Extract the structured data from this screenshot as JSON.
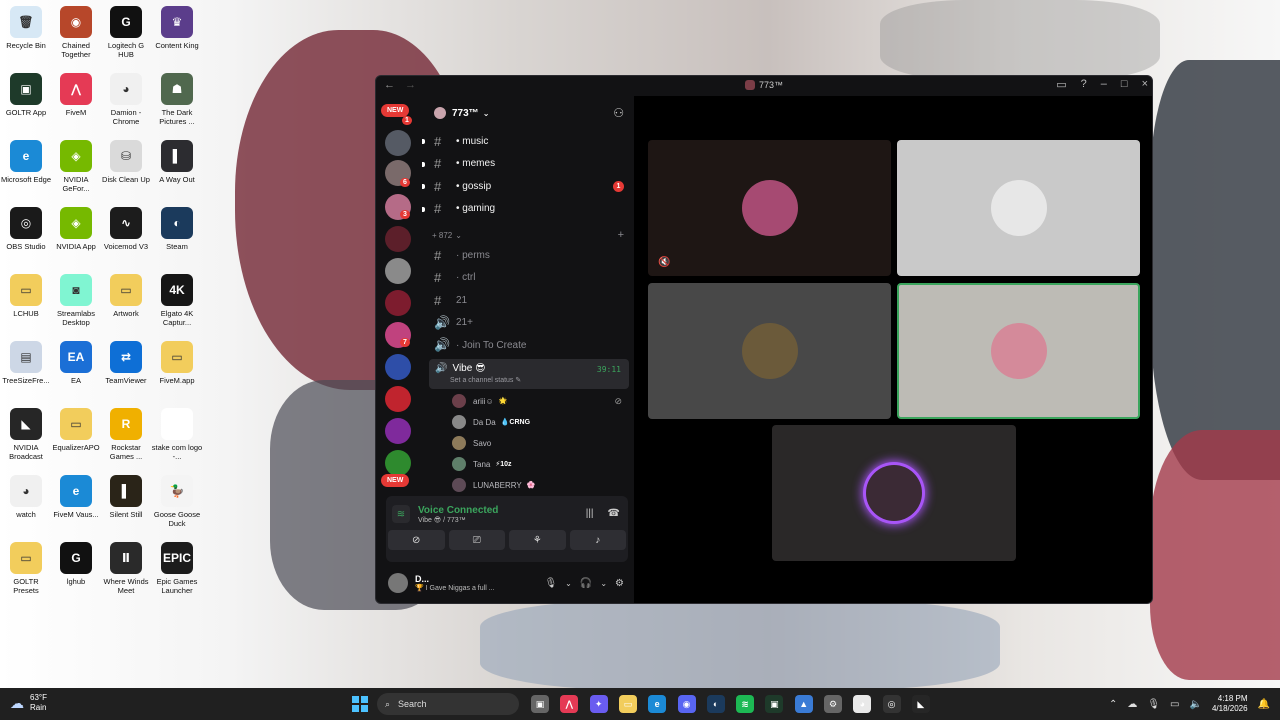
{
  "desktop": {
    "icons": [
      {
        "label": "Recycle Bin",
        "color": "#d7e8f5",
        "glyph": "🗑"
      },
      {
        "label": "Chained Together",
        "color": "#b7472a",
        "glyph": "◉"
      },
      {
        "label": "Logitech G HUB",
        "color": "#111111",
        "glyph": "G"
      },
      {
        "label": "Content King",
        "color": "#5b3d8b",
        "glyph": "♛"
      },
      {
        "label": "GOLTR App",
        "color": "#1e3a2a",
        "glyph": "▣"
      },
      {
        "label": "FiveM",
        "color": "#e53a55",
        "glyph": "⋀"
      },
      {
        "label": "Damion - Chrome",
        "color": "#f0f0f0",
        "glyph": "◕"
      },
      {
        "label": "The Dark Pictures ...",
        "color": "#50684e",
        "glyph": "☗"
      },
      {
        "label": "Microsoft Edge",
        "color": "#1b8ad6",
        "glyph": "e"
      },
      {
        "label": "NVIDIA GeFor...",
        "color": "#76b900",
        "glyph": "◈"
      },
      {
        "label": "Disk Clean Up",
        "color": "#dadada",
        "glyph": "⛁"
      },
      {
        "label": "A Way Out",
        "color": "#2c2c30",
        "glyph": "▌"
      },
      {
        "label": "OBS Studio",
        "color": "#1a1a1a",
        "glyph": "◎"
      },
      {
        "label": "NVIDIA App",
        "color": "#76b900",
        "glyph": "◈"
      },
      {
        "label": "Voicemod V3",
        "color": "#1c1c1c",
        "glyph": "∿"
      },
      {
        "label": "Steam",
        "color": "#1b3a5c",
        "glyph": "◐"
      },
      {
        "label": "LCHUB",
        "color": "#f2cd5c",
        "glyph": "▭"
      },
      {
        "label": "Streamlabs Desktop",
        "color": "#80f5d2",
        "glyph": "◙"
      },
      {
        "label": "Artwork",
        "color": "#f2cd5c",
        "glyph": "▭"
      },
      {
        "label": "Elgato 4K Captur...",
        "color": "#161616",
        "glyph": "4K"
      },
      {
        "label": "TreeSizeFre...",
        "color": "#cdd7e6",
        "glyph": "▤"
      },
      {
        "label": "EA",
        "color": "#1b6fd6",
        "glyph": "EA"
      },
      {
        "label": "TeamViewer",
        "color": "#0e6fd6",
        "glyph": "⇄"
      },
      {
        "label": "FiveM.app",
        "color": "#f2cd5c",
        "glyph": "▭"
      },
      {
        "label": "NVIDIA Broadcast",
        "color": "#262626",
        "glyph": "◣"
      },
      {
        "label": "EqualizerAPO",
        "color": "#f2cd5c",
        "glyph": "▭"
      },
      {
        "label": "Rockstar Games ...",
        "color": "#f0b000",
        "glyph": "R"
      },
      {
        "label": "stake com logo -...",
        "color": "#ffffff",
        "glyph": " "
      },
      {
        "label": "watch",
        "color": "#f0f0f0",
        "glyph": "◕"
      },
      {
        "label": "FiveM Vaus...",
        "color": "#1b8ad6",
        "glyph": "e"
      },
      {
        "label": "Silent Still",
        "color": "#2a2418",
        "glyph": "▌"
      },
      {
        "label": "Goose Goose Duck",
        "color": "#f4f4f4",
        "glyph": "🦆"
      },
      {
        "label": "GOLTR Presets",
        "color": "#f2cd5c",
        "glyph": "▭"
      },
      {
        "label": "lghub",
        "color": "#111111",
        "glyph": "G"
      },
      {
        "label": "Where Winds Meet",
        "color": "#2a2a2a",
        "glyph": "Ⅱ"
      },
      {
        "label": "Epic Games Launcher",
        "color": "#1c1c1c",
        "glyph": "EPIC"
      }
    ]
  },
  "discord": {
    "window_title": "773™",
    "server_name": "773™",
    "rail": {
      "new_label": "NEW",
      "badges": [
        "1",
        "6",
        "3",
        "7"
      ]
    },
    "channels": [
      {
        "name": "• music",
        "style": "bold"
      },
      {
        "name": "• memes",
        "style": "bold"
      },
      {
        "name": "• gossip",
        "style": "bold",
        "mention": "1"
      },
      {
        "name": "• gaming",
        "style": "bold"
      }
    ],
    "category": "+ 872",
    "dim_channels": [
      {
        "name": "· perms",
        "icon": "#"
      },
      {
        "name": "· ctrl",
        "icon": "#"
      },
      {
        "name": "21",
        "icon": "#"
      },
      {
        "name": "21+",
        "icon": "🔊"
      },
      {
        "name": "· Join To Create",
        "icon": "🔊"
      }
    ],
    "voice_channel": {
      "name": "Vibe 😎",
      "timer": "39:11",
      "status_placeholder": "Set a channel status"
    },
    "voice_users": [
      {
        "name": "ariii☺",
        "tag": "🌟",
        "color": "#6b3f4a",
        "muted": true
      },
      {
        "name": "Da Da",
        "tag": "💧CRNG",
        "color": "#888888",
        "muted": false
      },
      {
        "name": "Savo",
        "tag": "",
        "color": "#8d7a5a",
        "muted": false
      },
      {
        "name": "Tana",
        "tag": "⚡10z",
        "color": "#5f7f6a",
        "muted": false
      },
      {
        "name": "LUNABERRY",
        "tag": "🌸",
        "color": "#5d4a56",
        "muted": false
      }
    ],
    "voice_panel": {
      "title": "Voice Connected",
      "subtitle": "Vibe 😎 / 773™"
    },
    "user_panel": {
      "name": "D...",
      "status": "🏆 I Gave Niggas a full ..."
    },
    "tiles": [
      {
        "bg": "#1e1614",
        "pfp": "#a64a72",
        "border": "none",
        "muted": true
      },
      {
        "bg": "#c9c9c9",
        "pfp": "#e7e7e7",
        "border": "none",
        "muted": false
      },
      {
        "bg": "#484848",
        "pfp": "#6b5a3a",
        "border": "none",
        "muted": false
      },
      {
        "bg": "#bdbbb5",
        "pfp": "#d48a9a",
        "border": "#3ba55d",
        "muted": false
      },
      {
        "bg": "#2a2828",
        "pfp": "#3b2a35",
        "border": "none",
        "muted": false,
        "ring": "#a855f7"
      }
    ]
  },
  "taskbar": {
    "temp": "63°F",
    "condition": "Rain",
    "search_placeholder": "Search",
    "time": "4:18 PM",
    "date": "4/18/2026",
    "apps": [
      {
        "name": "task-view-icon",
        "color": "#666666",
        "glyph": "▣"
      },
      {
        "name": "fivem-icon",
        "color": "#e53a55",
        "glyph": "⋀"
      },
      {
        "name": "copilot-icon",
        "color": "#6a5cf0",
        "glyph": "✦"
      },
      {
        "name": "file-explorer-icon",
        "color": "#f2cd5c",
        "glyph": "▭"
      },
      {
        "name": "edge-icon",
        "color": "#1b8ad6",
        "glyph": "e"
      },
      {
        "name": "discord-icon",
        "color": "#5865f2",
        "glyph": "◉"
      },
      {
        "name": "steam-icon",
        "color": "#1b3a5c",
        "glyph": "◐"
      },
      {
        "name": "spotify-icon",
        "color": "#1db954",
        "glyph": "≋"
      },
      {
        "name": "xbox-icon",
        "color": "#1e3a2a",
        "glyph": "▣"
      },
      {
        "name": "photos-icon",
        "color": "#3a7bd5",
        "glyph": "▲"
      },
      {
        "name": "settings-icon",
        "color": "#666666",
        "glyph": "⚙"
      },
      {
        "name": "chrome-icon",
        "color": "#e9e9e9",
        "glyph": "◕"
      },
      {
        "name": "obs-icon",
        "color": "#333333",
        "glyph": "◎"
      },
      {
        "name": "nvidia-broadcast-icon",
        "color": "#262626",
        "glyph": "◣"
      }
    ]
  }
}
